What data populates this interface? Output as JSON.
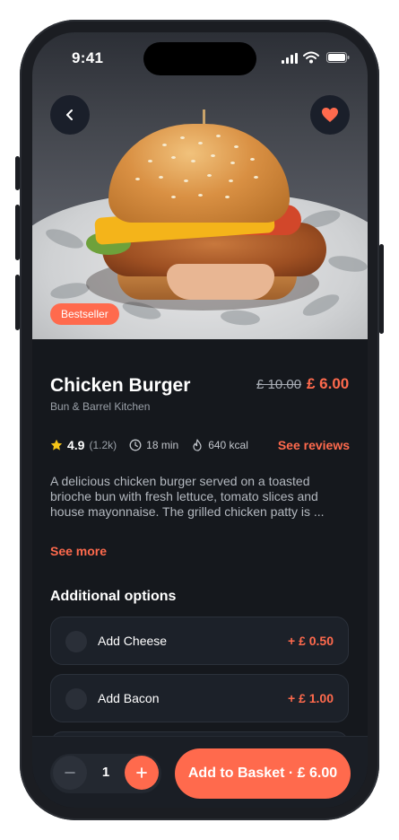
{
  "status_bar": {
    "time": "9:41"
  },
  "hero": {
    "badge": "Bestseller"
  },
  "product": {
    "name": "Chicken Burger",
    "restaurant": "Bun & Barrel Kitchen",
    "price_old": "£ 10.00",
    "price_new": "£ 6.00",
    "rating": "4.9",
    "rating_count": "(1.2k)",
    "time": "18 min",
    "calories": "640 kcal",
    "see_reviews": "See reviews",
    "description": "A delicious chicken burger served on a toasted brioche bun with fresh lettuce, tomato slices and house mayonnaise. The grilled chicken patty is ...",
    "see_more": "See more"
  },
  "options": {
    "title": "Additional options",
    "items": [
      {
        "name": "Add Cheese",
        "price": "+ £ 0.50"
      },
      {
        "name": "Add Bacon",
        "price": "+ £ 1.00"
      }
    ]
  },
  "cart": {
    "quantity": "1",
    "add_label": "Add to Basket · £ 6.00"
  },
  "colors": {
    "accent": "#ff6a4d",
    "background": "#15181d",
    "card": "#1c2129",
    "star": "#f5c518"
  },
  "icons": [
    "back-arrow-icon",
    "heart-icon",
    "star-icon",
    "clock-icon",
    "flame-icon",
    "minus-icon",
    "plus-icon"
  ]
}
